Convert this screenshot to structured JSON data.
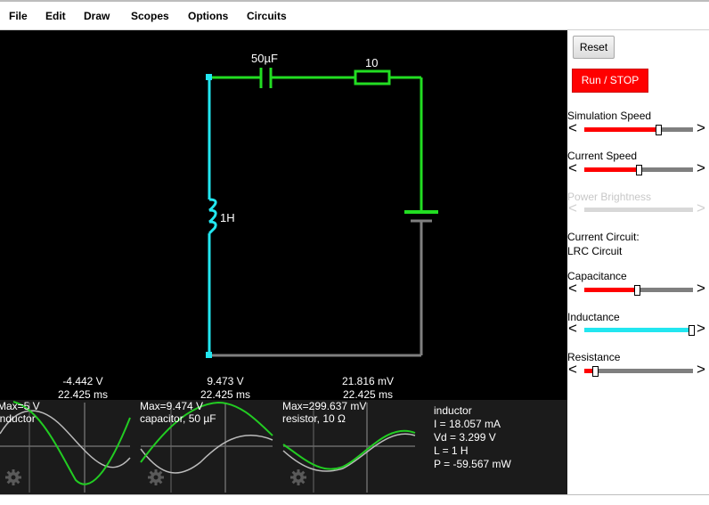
{
  "menu": {
    "items": [
      {
        "label": "File"
      },
      {
        "label": "Edit"
      },
      {
        "label": "Draw"
      },
      {
        "label": "Scopes"
      },
      {
        "label": "Options"
      },
      {
        "label": "Circuits"
      }
    ]
  },
  "circuit": {
    "capacitor_label": "50µF",
    "resistor_label": "10",
    "inductor_label": "1H",
    "colors": {
      "wire_green": "#22dd22",
      "wire_cyan": "#22e6f0",
      "wire_gray": "#7f7f7f"
    }
  },
  "panel": {
    "reset_label": "Reset",
    "run_stop_label": "Run / STOP",
    "sliders": [
      {
        "label": "Simulation Speed",
        "value": 0.68,
        "color": "#ff0000",
        "disabled": false
      },
      {
        "label": "Current Speed",
        "value": 0.5,
        "color": "#ff0000",
        "disabled": false
      },
      {
        "label": "Power Brightness",
        "value": 0.5,
        "color": "#d8d8d8",
        "disabled": true
      }
    ],
    "current_circuit_title": "Current Circuit:",
    "current_circuit_name": "LRC Circuit",
    "params": [
      {
        "label": "Capacitance",
        "value": 0.48,
        "color": "#ff0000"
      },
      {
        "label": "Inductance",
        "value": 1.0,
        "color": "#22e6f0"
      },
      {
        "label": "Resistance",
        "value": 0.1,
        "color": "#ff0000"
      }
    ],
    "accent_run": "#ff0000"
  },
  "scopes": [
    {
      "voltage": "-4.442 V",
      "time": "22.425 ms",
      "max": "Max=5 V",
      "name": "inductor"
    },
    {
      "voltage": "9.473 V",
      "time": "22.425 ms",
      "max": "Max=9.474 V",
      "name": "capacitor, 50 µF"
    },
    {
      "voltage": "21.816 mV",
      "time": "22.425 ms",
      "max": "Max=299.637 mV",
      "name": "resistor, 10 Ω"
    }
  ],
  "info": {
    "lines": [
      "inductor",
      "I = 18.057 mA",
      "Vd = 3.299 V",
      "L = 1 H",
      "P = -59.567 mW"
    ]
  },
  "icons": {
    "settings": "gear-icon"
  }
}
